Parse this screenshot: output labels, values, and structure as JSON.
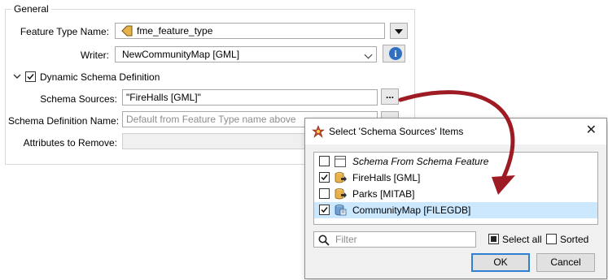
{
  "general": {
    "legend": "General",
    "feature_type_label": "Feature Type Name:",
    "feature_type_value": "fme_feature_type",
    "writer_label": "Writer:",
    "writer_value": "NewCommunityMap [GML]",
    "info_icon": "i",
    "dynamic_schema_label": "Dynamic Schema Definition",
    "dynamic_schema_checked": true,
    "schema_sources_label": "Schema Sources:",
    "schema_sources_value": "\"FireHalls [GML]\"",
    "schema_sources_button": "...",
    "schema_def_name_label": "Schema Definition Name:",
    "schema_def_name_placeholder": "Default from Feature Type name above",
    "attributes_remove_label": "Attributes to Remove:"
  },
  "dialog": {
    "title": "Select 'Schema Sources' Items",
    "close": "✕",
    "items": [
      {
        "label": "Schema From Schema Feature",
        "checked": false,
        "italic": true,
        "icon": "blank-schema-icon",
        "selected": false
      },
      {
        "label": "FireHalls [GML]",
        "checked": true,
        "italic": false,
        "icon": "gml-dataset-icon",
        "selected": false
      },
      {
        "label": "Parks [MITAB]",
        "checked": false,
        "italic": false,
        "icon": "mitab-dataset-icon",
        "selected": false
      },
      {
        "label": "CommunityMap [FILEGDB]",
        "checked": true,
        "italic": false,
        "icon": "filegdb-dataset-icon",
        "selected": true
      }
    ],
    "filter_placeholder": "Filter",
    "select_all_label": "Select all",
    "select_all_checked": true,
    "sorted_label": "Sorted",
    "sorted_checked": false,
    "ok_label": "OK",
    "cancel_label": "Cancel"
  },
  "colors": {
    "selection": "#cce8ff",
    "arrow": "#9e1b24",
    "accent": "#2f7fd3",
    "dataset_icon": "#e8b24a"
  }
}
